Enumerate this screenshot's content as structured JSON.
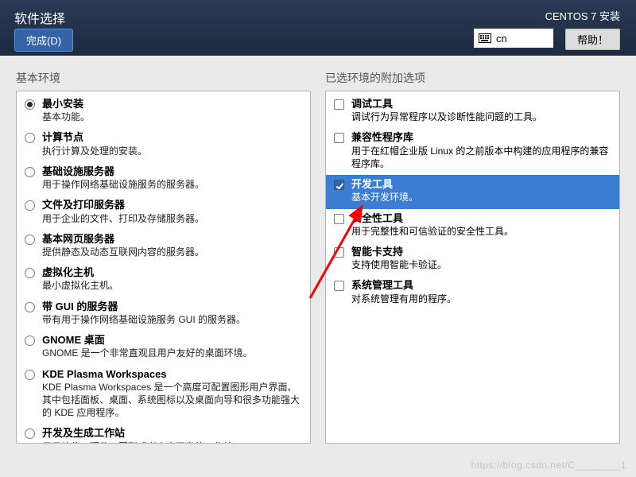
{
  "header": {
    "page_title": "软件选择",
    "done_button": "完成(D)",
    "installer_title": "CENTOS 7 安装",
    "keyboard_layout": "cn",
    "help_button": "帮助！"
  },
  "left": {
    "title": "基本环境",
    "items": [
      {
        "name": "最小安装",
        "desc": "基本功能。",
        "selected": true
      },
      {
        "name": "计算节点",
        "desc": "执行计算及处理的安装。",
        "selected": false
      },
      {
        "name": "基础设施服务器",
        "desc": "用于操作网络基础设施服务的服务器。",
        "selected": false
      },
      {
        "name": "文件及打印服务器",
        "desc": "用于企业的文件、打印及存储服务器。",
        "selected": false
      },
      {
        "name": "基本网页服务器",
        "desc": "提供静态及动态互联网内容的服务器。",
        "selected": false
      },
      {
        "name": "虚拟化主机",
        "desc": "最小虚拟化主机。",
        "selected": false
      },
      {
        "name": "带 GUI 的服务器",
        "desc": "带有用于操作网络基础设施服务 GUI 的服务器。",
        "selected": false
      },
      {
        "name": "GNOME 桌面",
        "desc": "GNOME 是一个非常直观且用户友好的桌面环境。",
        "selected": false
      },
      {
        "name": "KDE Plasma Workspaces",
        "desc": "KDE Plasma Workspaces 是一个高度可配置图形用户界面、其中包括面板、桌面、系统图标以及桌面向导和很多功能强大的 KDE 应用程序。",
        "selected": false
      },
      {
        "name": "开发及生成工作站",
        "desc": "用于软件、硬件、图形或者内容开发的工作站。",
        "selected": false
      }
    ]
  },
  "right": {
    "title": "已选环境的附加选项",
    "items": [
      {
        "name": "调试工具",
        "desc": "调试行为异常程序以及诊断性能问题的工具。",
        "checked": false,
        "highlight": false
      },
      {
        "name": "兼容性程序库",
        "desc": "用于在红帽企业版 Linux 的之前版本中构建的应用程序的兼容程序库。",
        "checked": false,
        "highlight": false
      },
      {
        "name": "开发工具",
        "desc": "基本开发环境。",
        "checked": true,
        "highlight": true
      },
      {
        "name": "安全性工具",
        "desc": "用于完整性和可信验证的安全性工具。",
        "checked": false,
        "highlight": false
      },
      {
        "name": "智能卡支持",
        "desc": "支持使用智能卡验证。",
        "checked": false,
        "highlight": false
      },
      {
        "name": "系统管理工具",
        "desc": "对系统管理有用的程序。",
        "checked": false,
        "highlight": false
      }
    ]
  },
  "watermark": "https://blog.csdn.net/C________1"
}
